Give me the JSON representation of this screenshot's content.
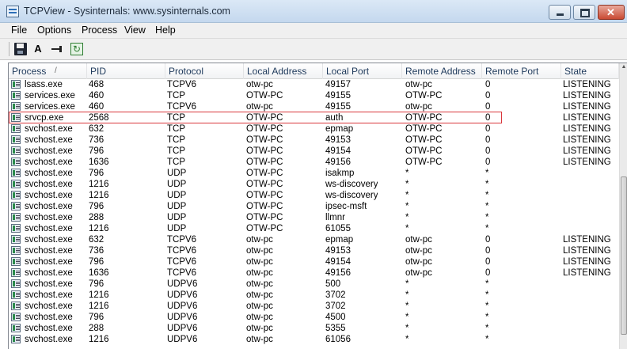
{
  "window": {
    "title": "TCPView - Sysinternals: www.sysinternals.com"
  },
  "menu": [
    "File",
    "Options",
    "Process",
    "View",
    "Help"
  ],
  "toolbar": {
    "font_label": "A",
    "refresh_glyph": "↻"
  },
  "table": {
    "columns": [
      "Process",
      "PID",
      "Protocol",
      "Local Address",
      "Local Port",
      "Remote Address",
      "Remote Port",
      "State"
    ],
    "sort_indicator": "/",
    "highlighted_row": 3,
    "rows": [
      [
        "lsass.exe",
        "468",
        "TCPV6",
        "otw-pc",
        "49157",
        "otw-pc",
        "0",
        "LISTENING"
      ],
      [
        "services.exe",
        "460",
        "TCP",
        "OTW-PC",
        "49155",
        "OTW-PC",
        "0",
        "LISTENING"
      ],
      [
        "services.exe",
        "460",
        "TCPV6",
        "otw-pc",
        "49155",
        "otw-pc",
        "0",
        "LISTENING"
      ],
      [
        "srvcp.exe",
        "2568",
        "TCP",
        "OTW-PC",
        "auth",
        "OTW-PC",
        "0",
        "LISTENING"
      ],
      [
        "svchost.exe",
        "632",
        "TCP",
        "OTW-PC",
        "epmap",
        "OTW-PC",
        "0",
        "LISTENING"
      ],
      [
        "svchost.exe",
        "736",
        "TCP",
        "OTW-PC",
        "49153",
        "OTW-PC",
        "0",
        "LISTENING"
      ],
      [
        "svchost.exe",
        "796",
        "TCP",
        "OTW-PC",
        "49154",
        "OTW-PC",
        "0",
        "LISTENING"
      ],
      [
        "svchost.exe",
        "1636",
        "TCP",
        "OTW-PC",
        "49156",
        "OTW-PC",
        "0",
        "LISTENING"
      ],
      [
        "svchost.exe",
        "796",
        "UDP",
        "OTW-PC",
        "isakmp",
        "*",
        "*",
        ""
      ],
      [
        "svchost.exe",
        "1216",
        "UDP",
        "OTW-PC",
        "ws-discovery",
        "*",
        "*",
        ""
      ],
      [
        "svchost.exe",
        "1216",
        "UDP",
        "OTW-PC",
        "ws-discovery",
        "*",
        "*",
        ""
      ],
      [
        "svchost.exe",
        "796",
        "UDP",
        "OTW-PC",
        "ipsec-msft",
        "*",
        "*",
        ""
      ],
      [
        "svchost.exe",
        "288",
        "UDP",
        "OTW-PC",
        "llmnr",
        "*",
        "*",
        ""
      ],
      [
        "svchost.exe",
        "1216",
        "UDP",
        "OTW-PC",
        "61055",
        "*",
        "*",
        ""
      ],
      [
        "svchost.exe",
        "632",
        "TCPV6",
        "otw-pc",
        "epmap",
        "otw-pc",
        "0",
        "LISTENING"
      ],
      [
        "svchost.exe",
        "736",
        "TCPV6",
        "otw-pc",
        "49153",
        "otw-pc",
        "0",
        "LISTENING"
      ],
      [
        "svchost.exe",
        "796",
        "TCPV6",
        "otw-pc",
        "49154",
        "otw-pc",
        "0",
        "LISTENING"
      ],
      [
        "svchost.exe",
        "1636",
        "TCPV6",
        "otw-pc",
        "49156",
        "otw-pc",
        "0",
        "LISTENING"
      ],
      [
        "svchost.exe",
        "796",
        "UDPV6",
        "otw-pc",
        "500",
        "*",
        "*",
        ""
      ],
      [
        "svchost.exe",
        "1216",
        "UDPV6",
        "otw-pc",
        "3702",
        "*",
        "*",
        ""
      ],
      [
        "svchost.exe",
        "1216",
        "UDPV6",
        "otw-pc",
        "3702",
        "*",
        "*",
        ""
      ],
      [
        "svchost.exe",
        "796",
        "UDPV6",
        "otw-pc",
        "4500",
        "*",
        "*",
        ""
      ],
      [
        "svchost.exe",
        "288",
        "UDPV6",
        "otw-pc",
        "5355",
        "*",
        "*",
        ""
      ],
      [
        "svchost.exe",
        "1216",
        "UDPV6",
        "otw-pc",
        "61056",
        "*",
        "*",
        ""
      ]
    ]
  }
}
